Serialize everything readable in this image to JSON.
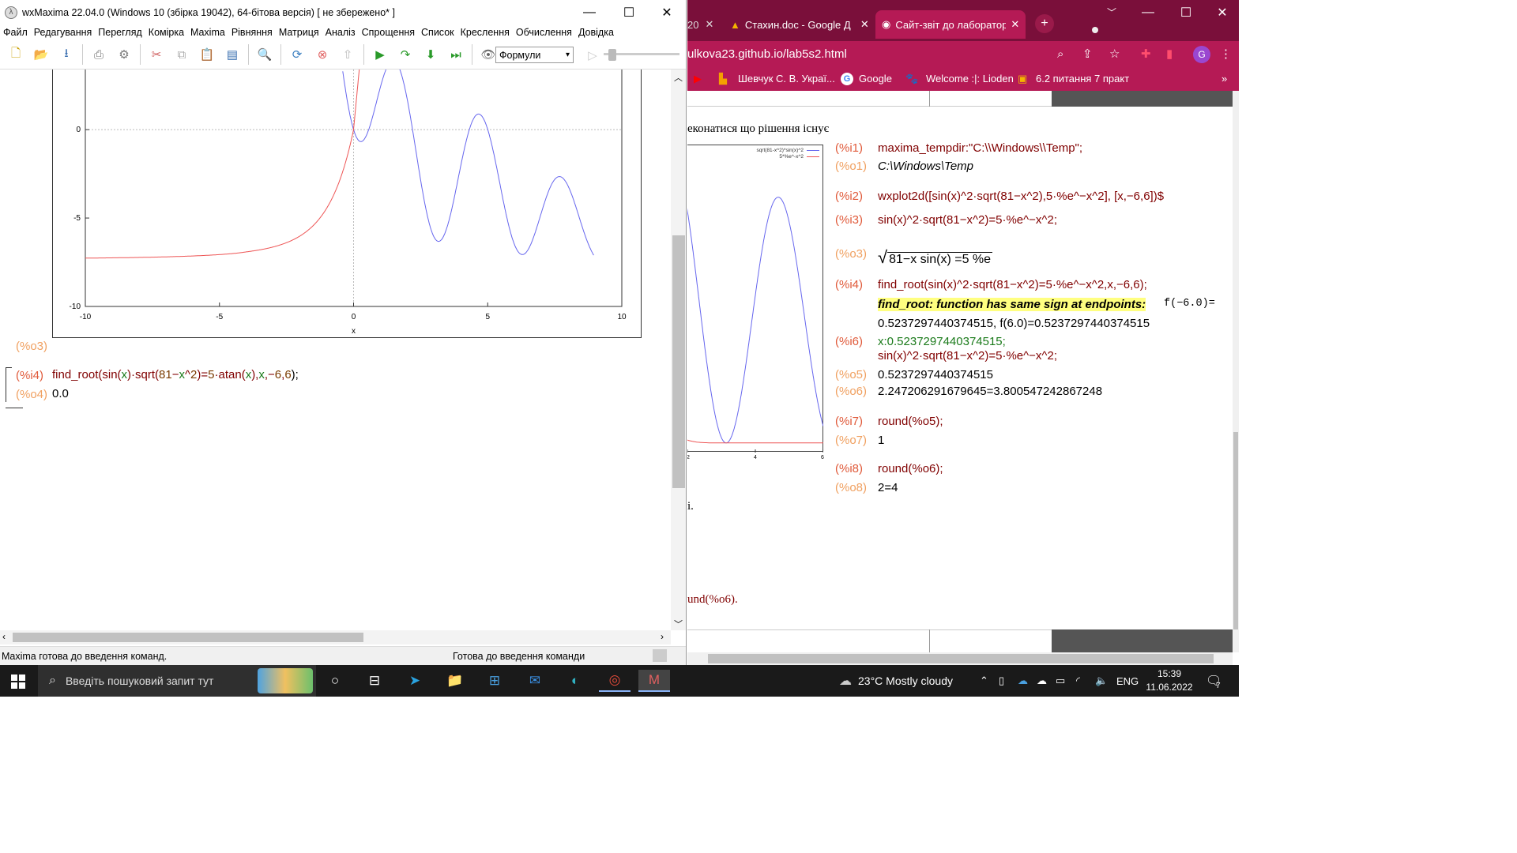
{
  "wxmaxima": {
    "title": "wxMaxima 22.04.0 (Windows 10 (збірка 19042), 64-бітова версія) [ не збережено* ]",
    "menu": [
      "Файл",
      "Редагування",
      "Перегляд",
      "Комірка",
      "Maxima",
      "Рівняння",
      "Матриця",
      "Аналіз",
      "Спрощення",
      "Список",
      "Креслення",
      "Обчислення",
      "Довідка"
    ],
    "style_select": "Формули",
    "plot": {
      "x_ticks": [
        "-10",
        "-5",
        "0",
        "5",
        "10"
      ],
      "y_ticks": [
        "0",
        "-5",
        "-10"
      ],
      "xlabel": "x",
      "blue_color": "#6666ee",
      "red_color": "#ee5555"
    },
    "cells": {
      "o3_label": "(%o3)",
      "i4_label": "(%i4)",
      "i4_parts": [
        "find_root(",
        "sin(",
        "x",
        ")·sqrt(",
        "81",
        "−",
        "x",
        "^",
        "2",
        ")=",
        "5",
        "·atan(",
        "x",
        "),",
        "x",
        ",−",
        "6",
        ",",
        "6",
        ");"
      ],
      "o4_label": "(%o4)",
      "o4_value": "0.0"
    },
    "status_left": "Maxima готова до введення команд.",
    "status_right": "Готова до введення команди"
  },
  "browser": {
    "tabs": [
      "20",
      "Стахин.doc - Google Д",
      "Сайт-звіт до лаборатор"
    ],
    "url": "ulkova23.github.io/lab5s2.html",
    "bookmarks": [
      "Шевчук С. В. Украї...",
      "Google",
      "Welcome :|: Lioden",
      "6.2 питання 7 практ"
    ],
    "page_intro": "еконатися що рішення існує",
    "page_footer_tail": "und(%o6).",
    "mini_plot_legend": [
      "sqrt(81-x^2)*sin(x)^2",
      "5*%e^-x^2"
    ],
    "mini_plot_ticks": [
      "2",
      "4",
      "6"
    ],
    "lines": [
      {
        "label": "(%i1)",
        "text": "maxima_tempdir:\"C:\\\\Windows\\\\Temp\";"
      },
      {
        "label": "(%o1)",
        "text": "C:\\Windows\\Temp"
      },
      {
        "label": "(%i2)",
        "text": "wxplot2d([sin(x)^2·sqrt(81−x^2),5·%e^−x^2], [x,−6,6])$"
      },
      {
        "label": "(%i3)",
        "text": "sin(x)^2·sqrt(81−x^2)=5·%e^−x^2;"
      },
      {
        "label": "(%o3)",
        "text": "81−x  sin(x)  =5 %e"
      },
      {
        "label": "(%i4)",
        "text": "find_root(sin(x)^2·sqrt(81−x^2)=5·%e^−x^2,x,−6,6);"
      },
      {
        "label": "",
        "text": "find_root: function has same sign at endpoints:"
      },
      {
        "label": "",
        "text": "f(−6.0)="
      },
      {
        "label": "",
        "text": "0.5237297440374515, f(6.0)=0.5237297440374515"
      },
      {
        "label": "(%i6)",
        "text": "x:0.5237297440374515;"
      },
      {
        "label": "",
        "text": "sin(x)^2·sqrt(81−x^2)=5·%e^−x^2;"
      },
      {
        "label": "(%o5)",
        "text": "0.5237297440374515"
      },
      {
        "label": "(%o6)",
        "text": "2.247206291679645=3.800547242867248"
      },
      {
        "label": "(%i7)",
        "text": "round(%o5);"
      },
      {
        "label": "(%o7)",
        "text": "1"
      },
      {
        "label": "(%i8)",
        "text": "round(%o6);"
      },
      {
        "label": "(%o8)",
        "text": "2=4"
      }
    ]
  },
  "taskbar": {
    "search_placeholder": "Введіть пошуковий запит тут",
    "weather": "23°C  Mostly cloudy",
    "lang": "ENG",
    "time": "15:39",
    "date": "11.06.2022",
    "notif_count": "7"
  }
}
